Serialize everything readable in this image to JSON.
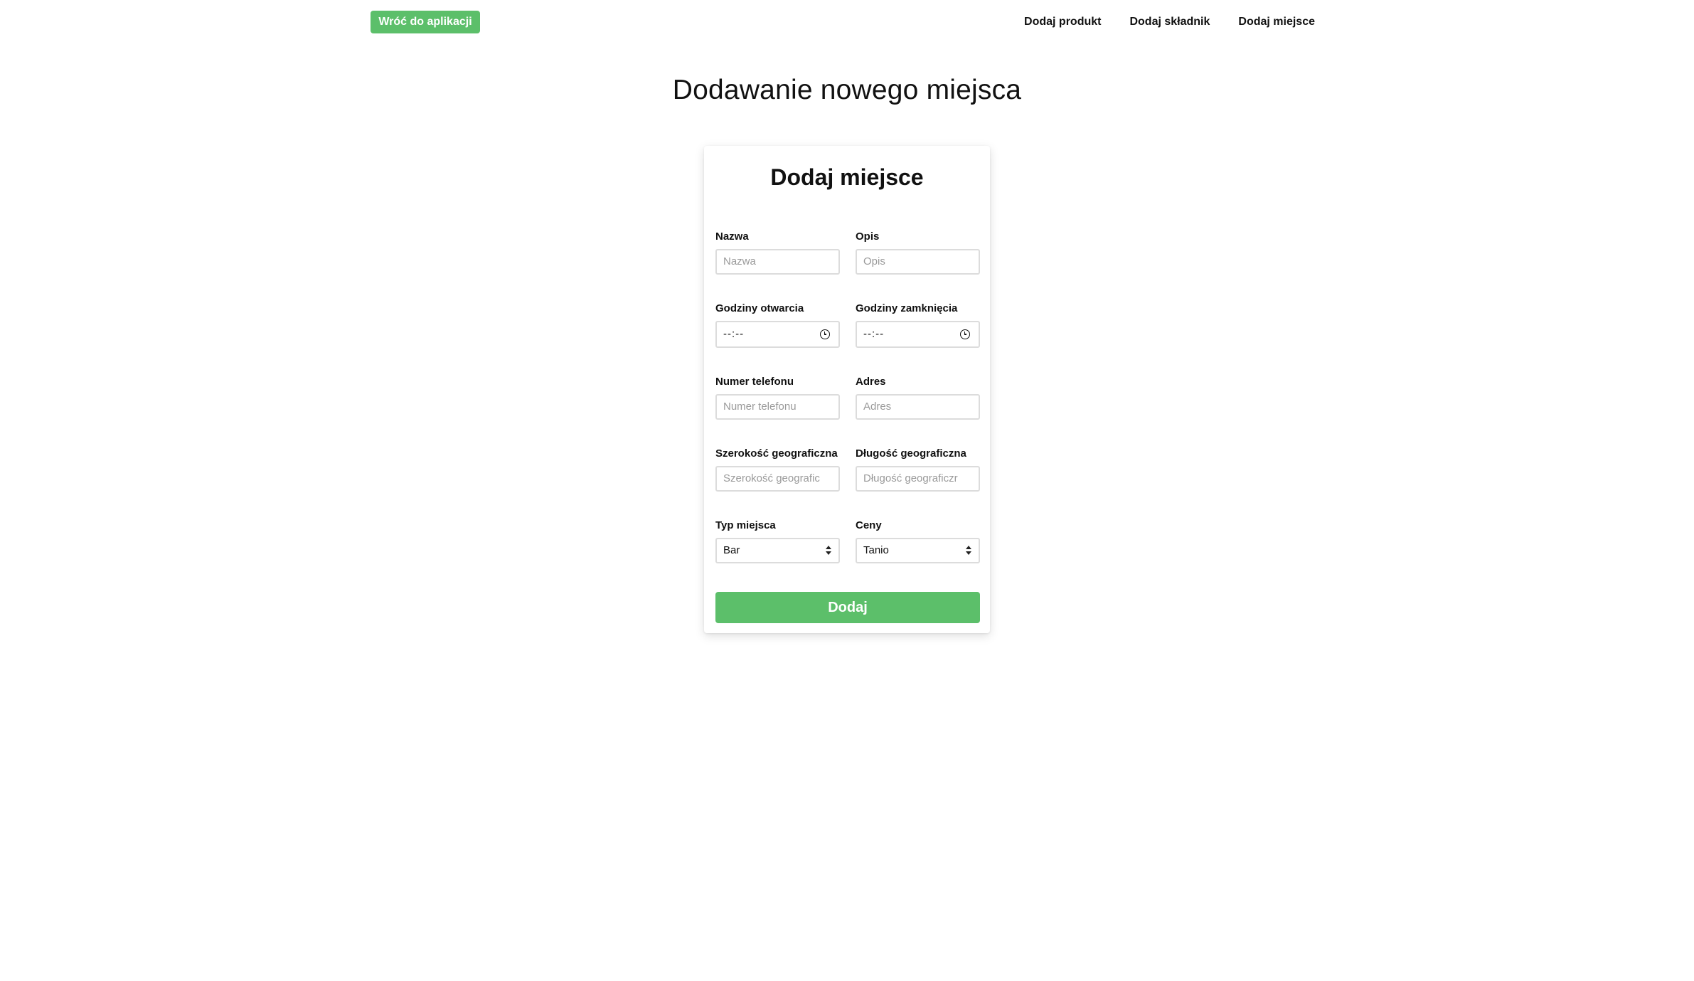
{
  "header": {
    "back_button": "Wróć do aplikacji",
    "nav": [
      "Dodaj produkt",
      "Dodaj składnik",
      "Dodaj miejsce"
    ]
  },
  "page_title": "Dodawanie nowego miejsca",
  "form": {
    "title": "Dodaj miejsce",
    "fields": {
      "name": {
        "label": "Nazwa",
        "placeholder": "Nazwa"
      },
      "description": {
        "label": "Opis",
        "placeholder": "Opis"
      },
      "opening_hours": {
        "label": "Godziny otwarcia",
        "value": "--:--"
      },
      "closing_hours": {
        "label": "Godziny zamknięcia",
        "value": "--:--"
      },
      "phone": {
        "label": "Numer telefonu",
        "placeholder": "Numer telefonu"
      },
      "address": {
        "label": "Adres",
        "placeholder": "Adres"
      },
      "latitude": {
        "label": "Szerokość geograficzna",
        "placeholder": "Szerokość geografic"
      },
      "longitude": {
        "label": "Długość geograficzna",
        "placeholder": "Długość geograficzr"
      },
      "place_type": {
        "label": "Typ miejsca",
        "selected": "Bar"
      },
      "prices": {
        "label": "Ceny",
        "selected": "Tanio"
      }
    },
    "submit_label": "Dodaj"
  },
  "colors": {
    "accent": "#5cbf6a",
    "input_border": "#dcdcdc",
    "placeholder": "#9a9a9a"
  }
}
